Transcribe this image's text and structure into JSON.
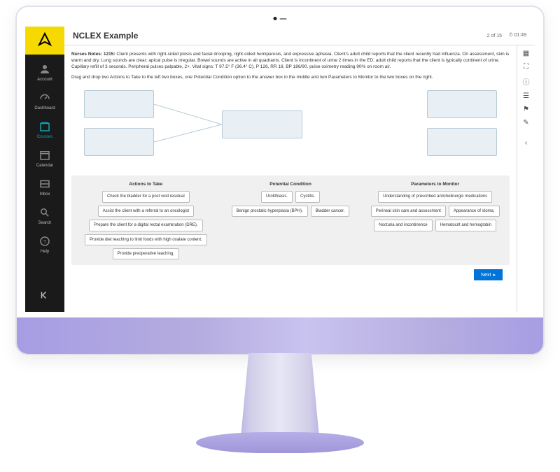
{
  "sidebar": {
    "items": [
      {
        "label": "Account",
        "icon": "account-icon"
      },
      {
        "label": "Dashboard",
        "icon": "dashboard-icon"
      },
      {
        "label": "Courses",
        "icon": "courses-icon",
        "active": true
      },
      {
        "label": "Calendar",
        "icon": "calendar-icon"
      },
      {
        "label": "Inbox",
        "icon": "inbox-icon"
      },
      {
        "label": "Search",
        "icon": "search-icon"
      },
      {
        "label": "Help",
        "icon": "help-icon"
      }
    ]
  },
  "header": {
    "title": "NCLEX Example",
    "progress": "2 of 15",
    "timer": "01:49"
  },
  "notes": {
    "prefix": "Nurses Notes: 1215:",
    "body": "Client presents with right-sided ptosis and facial drooping, right-sided hemiparesis, and expressive aphasia. Client's adult child reports that the client recently had influenza. On assessment, skin is warm and dry. Lung sounds are clear; apical pulse is irregular. Bowel sounds are active in all quadrants. Client is incontinent of urine 2 times in the ED; adult child reports that the client is typically continent of urine. Capillary refill of 3 seconds. Peripheral pulses palpable, 2+. Vital signs: T 97.5° F (36.4° C), P 126, RR 18, BP 186/90, pulse oximetry reading 90% on room air."
  },
  "instructions": "Drag and drop two Actions to Take to the left two boxes, one Potential Condition option to the answer box in the middle and two Parameters to Monitor to the two boxes on the right.",
  "categories": {
    "actions": {
      "title": "Actions to Take",
      "options": [
        "Check the bladder for a post void residual",
        "Assist the client with a referral to an oncologist",
        "Prepare the client for a digital rectal examination (DRE).",
        "Provide diet teaching to limit foods with high oxalate content.",
        "Provide preoperative teaching."
      ]
    },
    "condition": {
      "title": "Potential Condition",
      "options": [
        "Urolithiasis.",
        "Cystitis.",
        "Benign prostatic hyperplasia (BPH).",
        "Bladder cancer."
      ]
    },
    "parameters": {
      "title": "Parameters to Monitor",
      "options": [
        "Understanding of prescribed anticholinergic medications",
        "Perineal skin care and assessment",
        "Appearance of stoma.",
        "Nocturia and incontinence",
        "Hematocrit and hemoglobin"
      ]
    }
  },
  "footer": {
    "next_label": "Next"
  }
}
